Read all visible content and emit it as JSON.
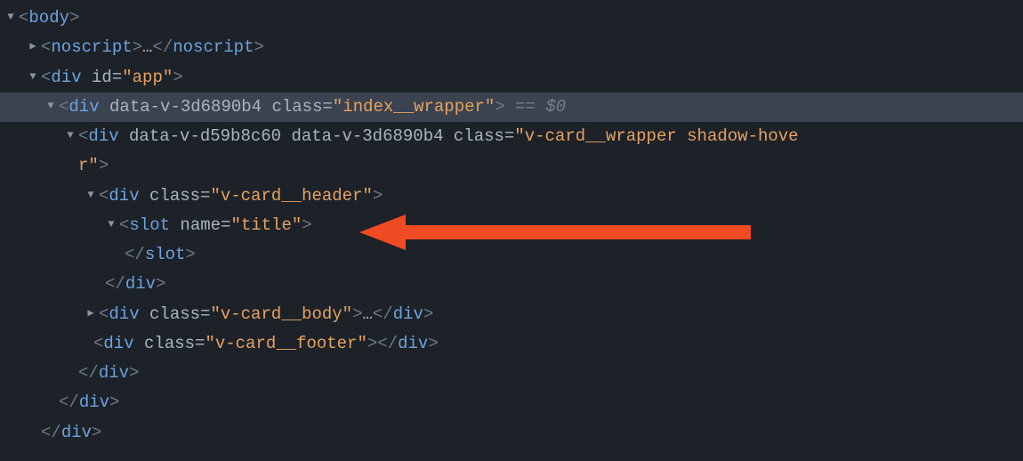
{
  "glyphs": {
    "down": "▼",
    "right": "▶"
  },
  "sel_suffix": "== $0",
  "nodes": {
    "body_open": {
      "tag": "body"
    },
    "noscript": {
      "tag": "noscript",
      "ell": "…"
    },
    "div_app": {
      "tag": "div",
      "attr_id": "id",
      "id_val": "\"app\""
    },
    "div_wrapper": {
      "tag": "div",
      "attr_dv": "data-v-3d6890b4",
      "attr_cls": "class",
      "cls_val": "\"index__wrapper\""
    },
    "div_card": {
      "tag": "div",
      "attr_dv1": "data-v-d59b8c60",
      "attr_dv2": "data-v-3d6890b4",
      "attr_cls": "class",
      "cls_line1": "\"v-card__wrapper shadow-hove",
      "cls_line2": "r\""
    },
    "div_header": {
      "tag": "div",
      "attr_cls": "class",
      "cls_val": "\"v-card__header\""
    },
    "slot": {
      "tag": "slot",
      "attr_name": "name",
      "name_val": "\"title\""
    },
    "div_body": {
      "tag": "div",
      "attr_cls": "class",
      "cls_val": "\"v-card__body\"",
      "ell": "…"
    },
    "div_footer": {
      "tag": "div",
      "attr_cls": "class",
      "cls_val": "\"v-card__footer\""
    },
    "close_div": "div",
    "close_slot": "slot"
  }
}
